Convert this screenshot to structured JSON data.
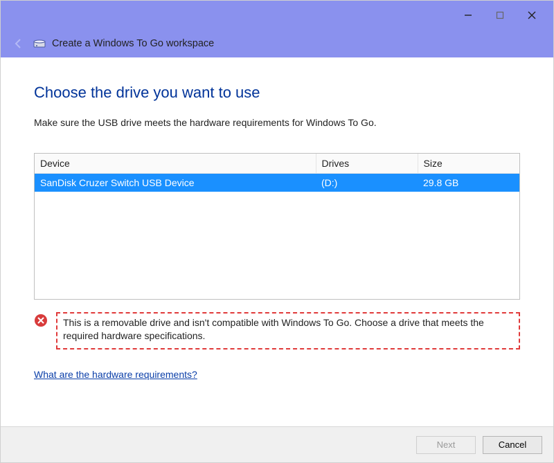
{
  "titlebar": {
    "wizard_title": "Create a Windows To Go workspace"
  },
  "page": {
    "heading": "Choose the drive you want to use",
    "instruction": "Make sure the USB drive meets the hardware requirements for Windows To Go."
  },
  "table": {
    "headers": {
      "device": "Device",
      "drives": "Drives",
      "size": "Size"
    },
    "rows": [
      {
        "device": "SanDisk Cruzer Switch USB Device",
        "drives": "(D:)",
        "size": "29.8 GB",
        "selected": true
      }
    ]
  },
  "error": {
    "message": "This is a removable drive and isn't compatible with Windows To Go. Choose a drive that meets the required hardware specifications."
  },
  "help": {
    "link_label": "What are the hardware requirements?"
  },
  "footer": {
    "next_label": "Next",
    "cancel_label": "Cancel",
    "next_enabled": false
  }
}
